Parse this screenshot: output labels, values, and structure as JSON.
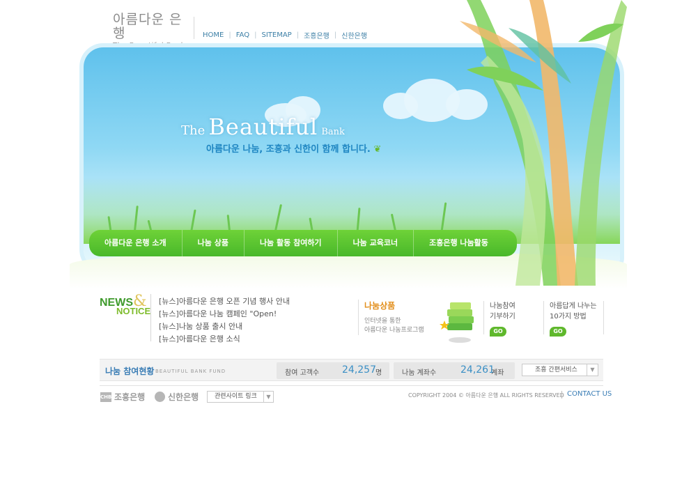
{
  "logo": {
    "ko": "아름다운 은행",
    "en": "The Beautiful Bank"
  },
  "topnav": [
    "HOME",
    "FAQ",
    "SITEMAP",
    "조흥은행",
    "신한은행"
  ],
  "hero": {
    "title_the": "The",
    "title_main": "Beautiful",
    "title_bank": "Bank",
    "subtitle": "아름다운 나눔, 조흥과 신한이 함께 합니다."
  },
  "mainnav": [
    "아름다운 은행 소개",
    "나눔 상품",
    "나눔 활동 참여하기",
    "나눔 교육코너",
    "조흥은행 나눔활동"
  ],
  "news": {
    "logo_top": "NEWS",
    "logo_amp": "&",
    "logo_bottom": "NOTICE",
    "items": [
      "[뉴스]아름다운 은행 오픈 기념 행사 안내",
      "[뉴스]아름다운 나눔 캠페인 \"Open!",
      "[뉴스]나눔 상품 출시 안내",
      "[뉴스]아름다운 은행 소식"
    ]
  },
  "product": {
    "title": "나눔상품",
    "desc_line1": "인터넷을 통한",
    "desc_line2": "아름다운 나눔프로그램"
  },
  "participate": {
    "line1": "나눔참여",
    "line2": "기부하기",
    "go": "GO"
  },
  "ways": {
    "line1": "아름답게 나누는",
    "line2": "10가지 방법",
    "go": "GO"
  },
  "status": {
    "title": "나눔 참여현황",
    "subtitle": "BEAUTIFUL BANK FUND",
    "customers_label": "참여 고객수",
    "customers_value": "24,257",
    "customers_unit": "명",
    "accounts_label": "나눔 계좌수",
    "accounts_value": "24,261",
    "accounts_unit": "계좌",
    "service_select": "조흥 간편서비스"
  },
  "footer": {
    "chohung": "조흥은행",
    "chohung_mark": "CHB",
    "shinhan": "신한은행",
    "related": "관련사이트 링크",
    "copyright": "COPYRIGHT 2004 © 아름다운 은행 ALL RIGHTS RESERVED",
    "contact": "CONTACT US"
  }
}
